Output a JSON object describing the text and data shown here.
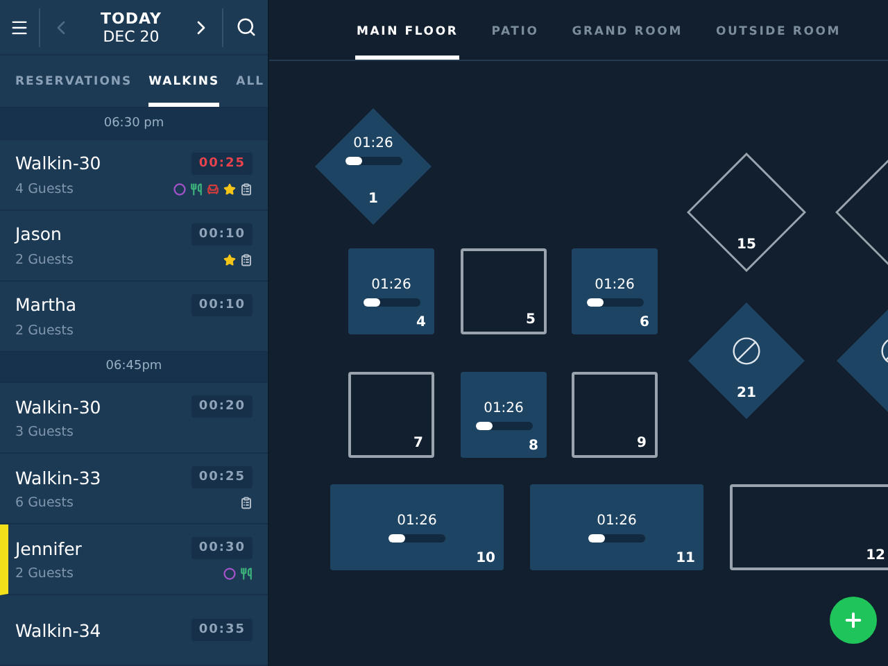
{
  "header": {
    "day": "TODAY",
    "date": "DEC 20"
  },
  "list_tabs": [
    {
      "label": "RESERVATIONS",
      "selected": false
    },
    {
      "label": "WALKINS",
      "selected": true
    },
    {
      "label": "ALL",
      "selected": false
    }
  ],
  "groups": [
    {
      "time": "06:30 pm",
      "guests": [
        {
          "name": "Walkin-30",
          "party": "4 Guests",
          "timer": "00:25",
          "overdue": true,
          "selected": false,
          "tags": [
            {
              "kind": "circle"
            },
            {
              "kind": "utensils"
            },
            {
              "kind": "chair"
            },
            {
              "kind": "star"
            },
            {
              "kind": "clipboard"
            }
          ]
        },
        {
          "name": "Jason",
          "party": "2 Guests",
          "timer": "00:10",
          "overdue": false,
          "selected": false,
          "tags": [
            {
              "kind": "star"
            },
            {
              "kind": "clipboard"
            }
          ]
        },
        {
          "name": "Martha",
          "party": "2 Guests",
          "timer": "00:10",
          "overdue": false,
          "selected": false
        }
      ]
    },
    {
      "time": "06:45pm",
      "guests": [
        {
          "name": "Walkin-30",
          "party": "3 Guests",
          "timer": "00:20",
          "overdue": false,
          "selected": false
        },
        {
          "name": "Walkin-33",
          "party": "6 Guests",
          "timer": "00:25",
          "overdue": false,
          "selected": false,
          "tags": [
            {
              "kind": "clipboard"
            }
          ]
        },
        {
          "name": "Jennifer",
          "party": "2 Guests",
          "timer": "00:30",
          "overdue": false,
          "selected": true,
          "tags": [
            {
              "kind": "circle"
            },
            {
              "kind": "utensils"
            }
          ]
        },
        {
          "name": "Walkin-34",
          "timer": "00:35",
          "overdue": false,
          "selected": false
        }
      ]
    }
  ],
  "room_tabs": [
    {
      "label": "MAIN FLOOR",
      "selected": true
    },
    {
      "label": "PATIO",
      "selected": false
    },
    {
      "label": "GRAND ROOM",
      "selected": false
    },
    {
      "label": "OUTSIDE ROOM",
      "selected": false
    }
  ],
  "tables": [
    {
      "number": "1",
      "kind": "diamond",
      "occupied": true,
      "blocked": false,
      "time": "01:26",
      "level": 0.3
    },
    {
      "number": "4",
      "kind": "square",
      "occupied": true,
      "blocked": false,
      "time": "01:26",
      "level": 0.3
    },
    {
      "number": "5",
      "kind": "square",
      "occupied": false,
      "blocked": false
    },
    {
      "number": "6",
      "kind": "square",
      "occupied": true,
      "blocked": false,
      "time": "01:26",
      "level": 0.3
    },
    {
      "number": "7",
      "kind": "square",
      "occupied": false,
      "blocked": false
    },
    {
      "number": "8",
      "kind": "square",
      "occupied": true,
      "blocked": false,
      "time": "01:26",
      "level": 0.3
    },
    {
      "number": "9",
      "kind": "square",
      "occupied": false,
      "blocked": false
    },
    {
      "number": "10",
      "kind": "wide",
      "occupied": true,
      "blocked": false,
      "time": "01:26",
      "level": 0.3
    },
    {
      "number": "11",
      "kind": "wide",
      "occupied": true,
      "blocked": false,
      "time": "01:26",
      "level": 0.3
    },
    {
      "number": "12",
      "kind": "wide",
      "occupied": false,
      "blocked": false
    },
    {
      "number": "15",
      "kind": "diamond",
      "occupied": false,
      "blocked": false
    },
    {
      "kind": "diamond",
      "occupied": false,
      "blocked": false
    },
    {
      "number": "21",
      "kind": "diamond",
      "occupied": false,
      "blocked": true
    },
    {
      "kind": "diamond",
      "occupied": false,
      "blocked": true
    }
  ]
}
